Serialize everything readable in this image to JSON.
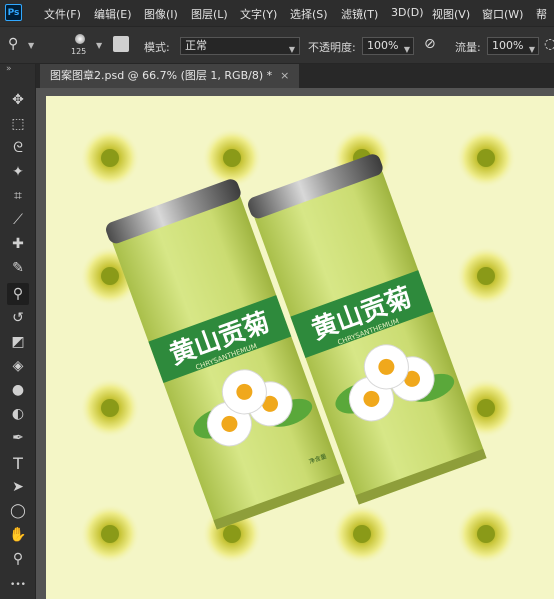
{
  "app": {
    "logo": "Ps"
  },
  "menu": [
    "文件(F)",
    "编辑(E)",
    "图像(I)",
    "图层(L)",
    "文字(Y)",
    "选择(S)",
    "滤镜(T)",
    "3D(D)",
    "视图(V)",
    "窗口(W)",
    "帮"
  ],
  "options": {
    "brush_size": "125",
    "mode_label": "模式:",
    "mode_value": "正常",
    "opacity_label": "不透明度:",
    "opacity_value": "100%",
    "flow_label": "流量:",
    "flow_value": "100%"
  },
  "document": {
    "tab_title": "图案图章2.psd @ 66.7% (图层 1, RGB/8) *",
    "close": "×"
  },
  "toolbar": {
    "collapse": "»",
    "tools": [
      {
        "icon": "move-icon",
        "glyph": "✥"
      },
      {
        "icon": "marquee-icon",
        "glyph": "⬚"
      },
      {
        "icon": "lasso-icon",
        "glyph": "ᘓ"
      },
      {
        "icon": "magic-wand-icon",
        "glyph": "✦"
      },
      {
        "icon": "crop-icon",
        "glyph": "⌗"
      },
      {
        "icon": "eyedropper-icon",
        "glyph": "⟋"
      },
      {
        "icon": "healing-brush-icon",
        "glyph": "✚"
      },
      {
        "icon": "brush-icon",
        "glyph": "✎"
      },
      {
        "icon": "pattern-stamp-icon",
        "glyph": "⚲"
      },
      {
        "icon": "history-brush-icon",
        "glyph": "↺"
      },
      {
        "icon": "eraser-icon",
        "glyph": "◩"
      },
      {
        "icon": "paint-bucket-icon",
        "glyph": "◈"
      },
      {
        "icon": "blur-icon",
        "glyph": "●"
      },
      {
        "icon": "dodge-icon",
        "glyph": "◐"
      },
      {
        "icon": "pen-icon",
        "glyph": "✒"
      },
      {
        "icon": "type-icon",
        "glyph": "T"
      },
      {
        "icon": "path-selection-icon",
        "glyph": "➤"
      },
      {
        "icon": "ellipse-icon",
        "glyph": "◯"
      },
      {
        "icon": "hand-icon",
        "glyph": "✋"
      },
      {
        "icon": "zoom-icon",
        "glyph": "⚲"
      },
      {
        "icon": "more-tools-icon",
        "glyph": "•••"
      }
    ]
  },
  "artwork": {
    "can_title": "黄山贡菊",
    "can_subtitle": "CHRYSANTHEMUM",
    "can_small": "净含量",
    "can_color": "#cfe07a",
    "band_color": "#2e8a3c"
  }
}
